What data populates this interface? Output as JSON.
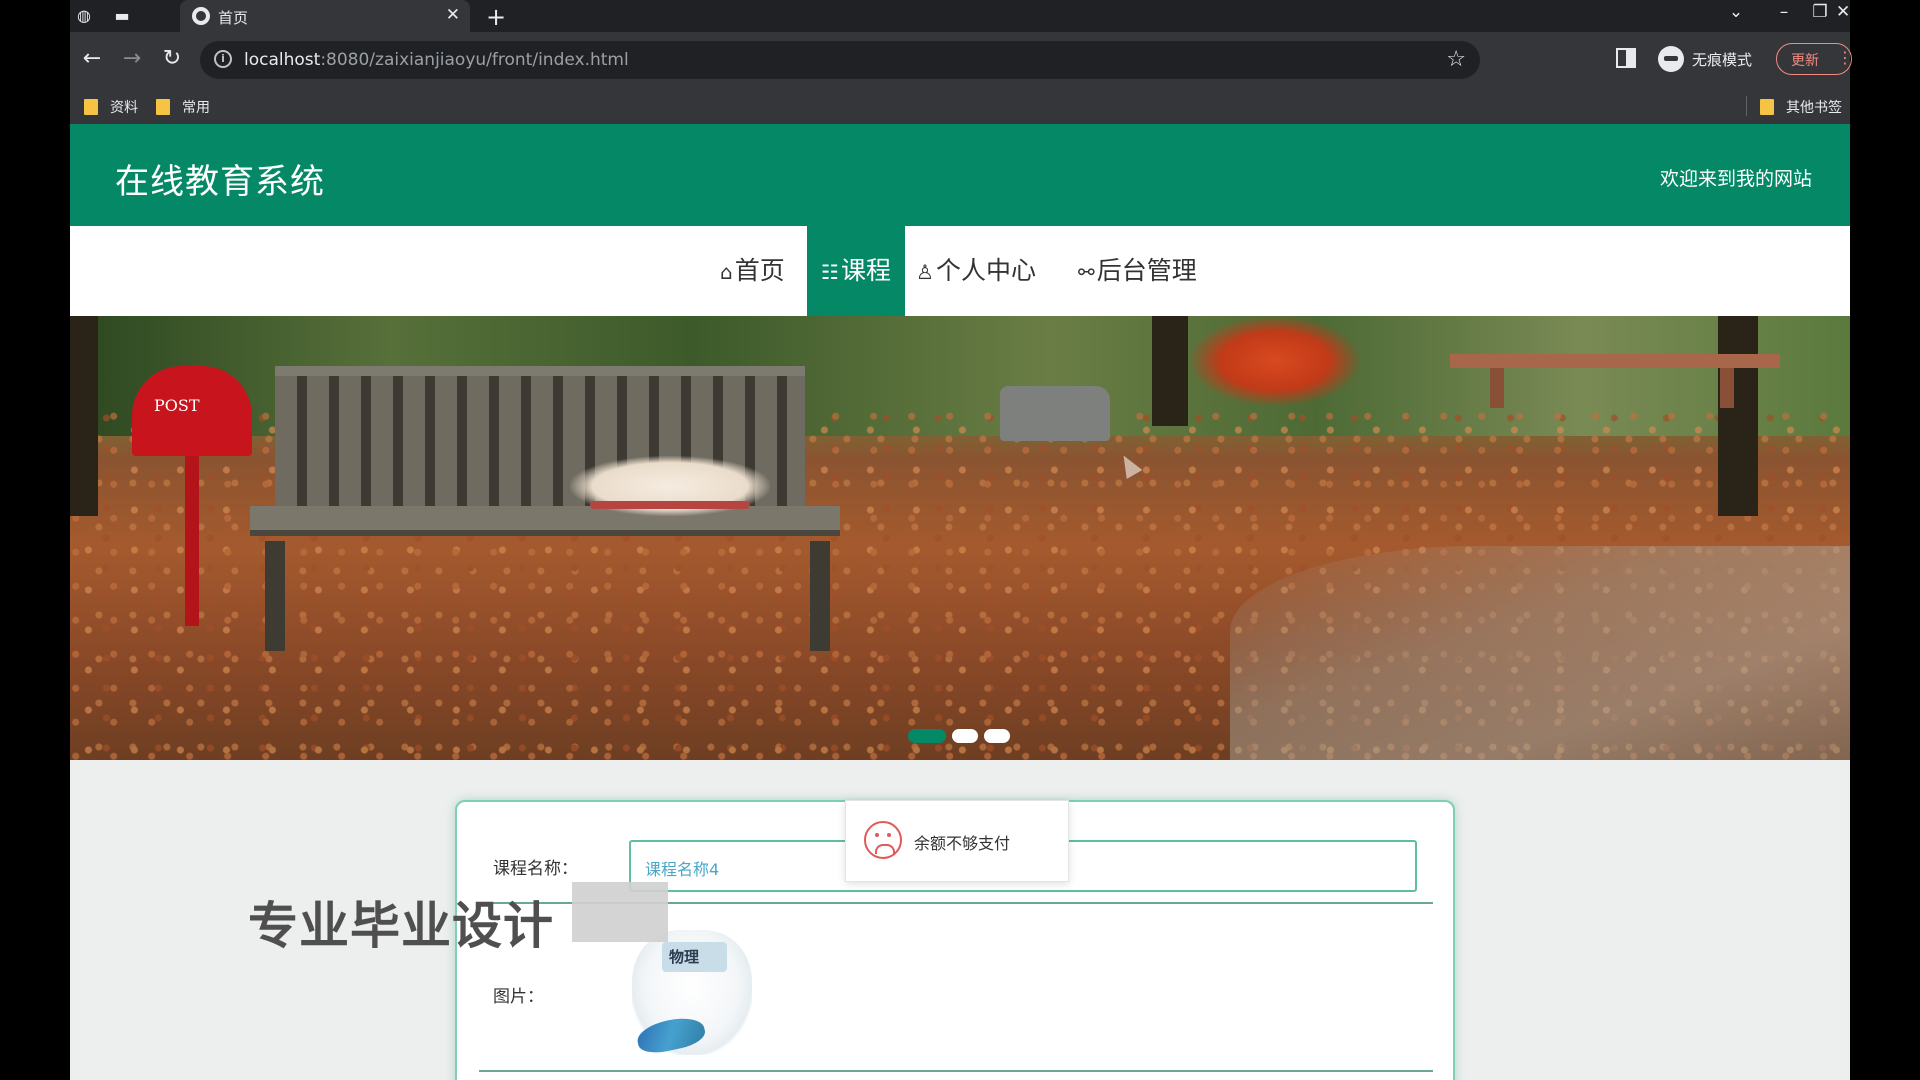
{
  "browser": {
    "tab_title": "首页",
    "url_host": "localhost",
    "url_path": ":8080/zaixianjiaoyu/front/index.html",
    "incognito_label": "无痕模式",
    "update_label": "更新",
    "bookmarks": [
      "资料",
      "常用"
    ],
    "other_bookmarks": "其他书签"
  },
  "site": {
    "title": "在线教育系统",
    "welcome": "欢迎来到我的网站"
  },
  "nav": {
    "items": [
      {
        "icon": "⌂",
        "label": "首页"
      },
      {
        "icon": "☷",
        "label": "课程"
      },
      {
        "icon": "♙",
        "label": "个人中心"
      },
      {
        "icon": "⚯",
        "label": "后台管理"
      }
    ],
    "active_index": 1
  },
  "banner": {
    "post_text": "POST",
    "slide_count": 3,
    "active_slide": 1
  },
  "form": {
    "course_name_label": "课程名称：",
    "course_name_value": "课程名称4",
    "picture_label": "图片：",
    "picture_text": "物理"
  },
  "toast": {
    "message": "余额不够支付"
  },
  "watermark": "专业毕业设计",
  "colors": {
    "brand_green": "#058866",
    "error_red": "#e05a5a"
  }
}
